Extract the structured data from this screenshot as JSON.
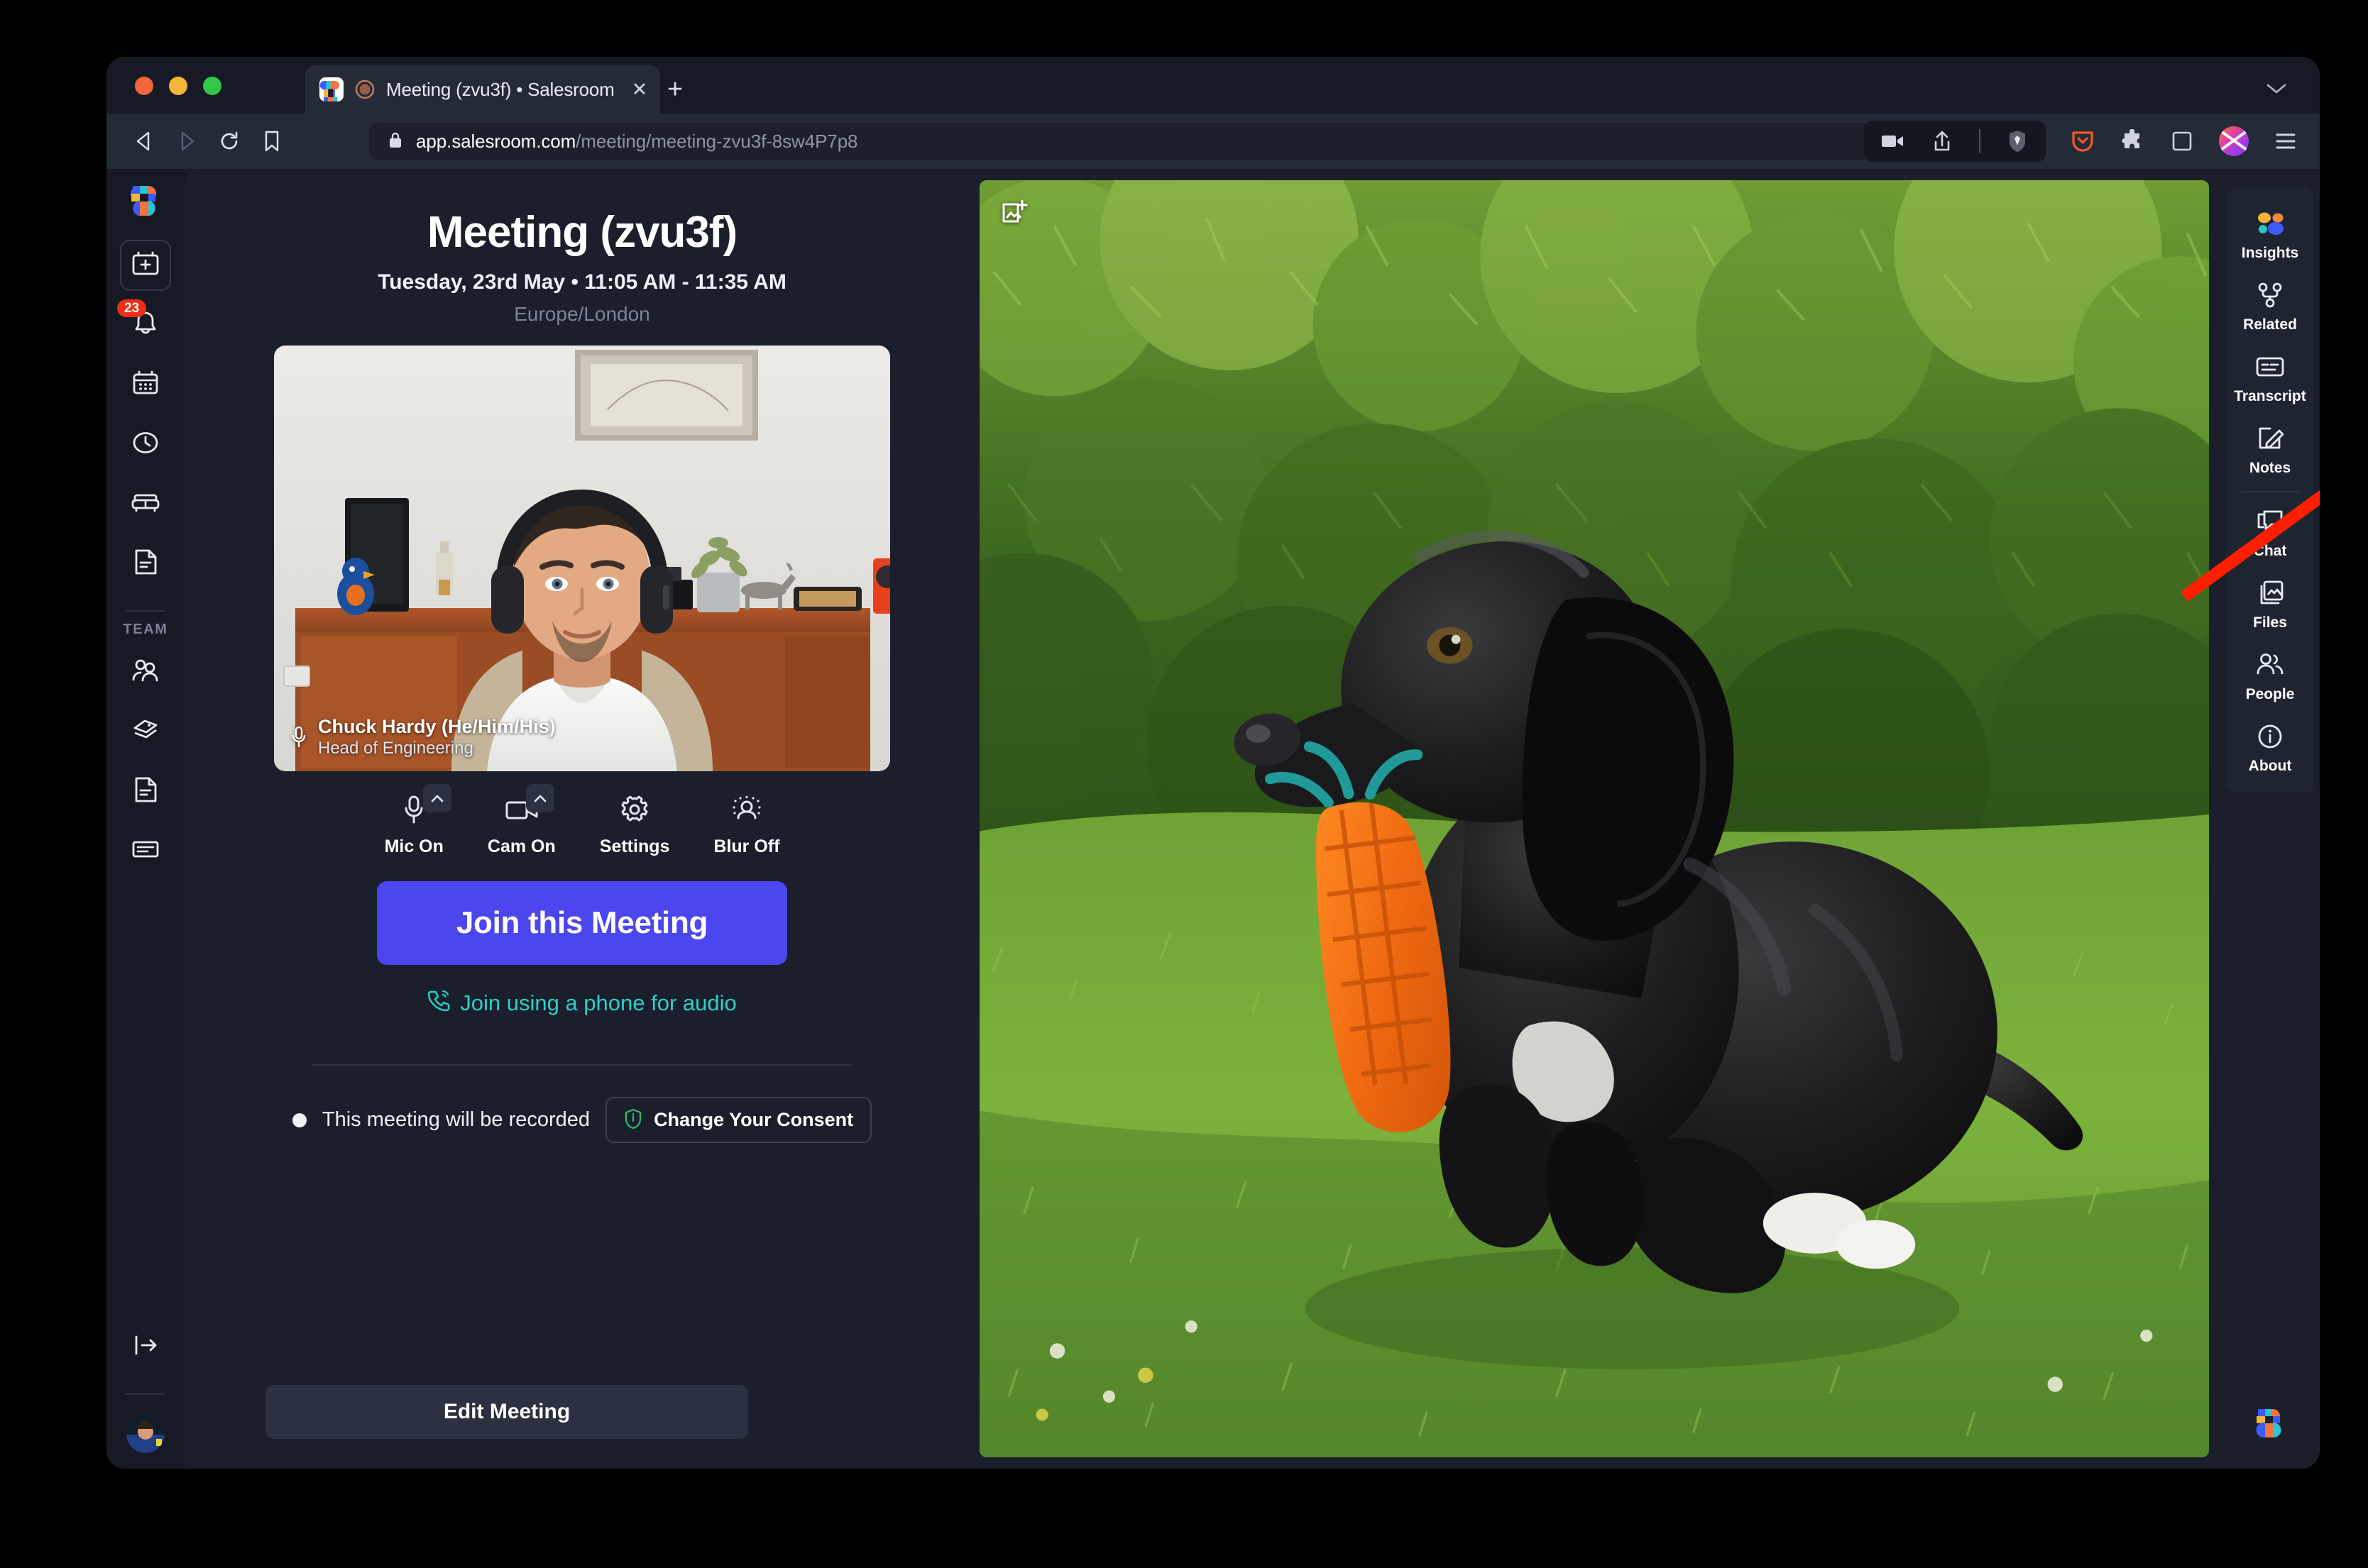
{
  "browser": {
    "tab": {
      "title": "Meeting (zvu3f) • Salesroom",
      "close_label": "✕",
      "favicon_name": "salesroom-favicon"
    },
    "new_tab_label": "+",
    "url": {
      "host": "app.salesroom.com",
      "path": "/meeting/meeting-zvu3f-8sw4P7p8"
    },
    "toolbar_icons": [
      "back-icon",
      "forward-icon",
      "reload-icon",
      "bookmark-icon"
    ],
    "right_icons": [
      "screencast-icon",
      "share-icon",
      "brave-shields-icon",
      "pocket-icon",
      "extensions-icon",
      "sidebar-icon",
      "profile-avatar",
      "browser-menu-icon"
    ]
  },
  "left_rail": {
    "logo_name": "salesroom-logo",
    "items": [
      {
        "name": "new-meeting",
        "icon": "calendar-plus-icon",
        "boxed": true
      },
      {
        "name": "notifications",
        "icon": "bell-icon",
        "badge": "23"
      },
      {
        "name": "calendar",
        "icon": "calendar-icon"
      },
      {
        "name": "history",
        "icon": "clock-icon"
      },
      {
        "name": "rooms",
        "icon": "sofa-icon"
      },
      {
        "name": "documents",
        "icon": "document-icon"
      }
    ],
    "section_label": "TEAM",
    "team_items": [
      {
        "name": "team-people",
        "icon": "people-add-icon"
      },
      {
        "name": "team-tags",
        "icon": "tags-icon"
      },
      {
        "name": "team-documents",
        "icon": "document-icon"
      },
      {
        "name": "team-transcripts",
        "icon": "transcript-lines-icon"
      }
    ],
    "logout": {
      "name": "logout",
      "icon": "logout-arrow-icon"
    },
    "avatar_name": "user-avatar"
  },
  "meeting": {
    "title": "Meeting (zvu3f)",
    "when": "Tuesday, 23rd May • 11:05 AM - 11:35 AM",
    "timezone": "Europe/London",
    "selfview": {
      "name": "Chuck Hardy (He/Him/His)",
      "role": "Head of Engineering",
      "mic_icon": "microphone-icon"
    },
    "controls": [
      {
        "label": "Mic On",
        "icon": "microphone-icon",
        "caret": true
      },
      {
        "label": "Cam On",
        "icon": "camera-icon",
        "caret": true
      },
      {
        "label": "Settings",
        "icon": "gear-icon",
        "caret": false
      },
      {
        "label": "Blur Off",
        "icon": "person-blur-icon",
        "caret": false
      }
    ],
    "join_label": "Join this Meeting",
    "phone_link": "Join using a phone for audio",
    "phone_icon": "phone-ring-icon",
    "recording_notice": "This meeting will be recorded",
    "consent_button": "Change Your Consent",
    "consent_icon": "shield-info-icon",
    "edit_label": "Edit Meeting"
  },
  "share": {
    "add_image_icon": "add-image-icon",
    "scene": "dog-with-carrot-toy-on-lawn"
  },
  "right_rail": {
    "top_items": [
      {
        "label": "Insights",
        "icon": "insights-dots-icon"
      },
      {
        "label": "Related",
        "icon": "related-nodes-icon"
      },
      {
        "label": "Transcript",
        "icon": "transcript-icon"
      },
      {
        "label": "Notes",
        "icon": "notes-pencil-icon"
      }
    ],
    "bottom_items": [
      {
        "label": "Chat",
        "icon": "chat-icon"
      },
      {
        "label": "Files",
        "icon": "files-image-icon"
      },
      {
        "label": "People",
        "icon": "people-icon"
      },
      {
        "label": "About",
        "icon": "info-circle-icon"
      }
    ],
    "logo_name": "salesroom-logo"
  },
  "annotation": {
    "type": "red-arrow",
    "color": "#ff1e00",
    "points_to": "Transcript"
  },
  "colors": {
    "accent_blue": "#4b46ef",
    "link_teal": "#2ad1c9",
    "badge_red": "#f02e16",
    "window_bg": "#171a24",
    "stage_bg": "#1b1f2b",
    "panel_bg": "#1f2431"
  }
}
